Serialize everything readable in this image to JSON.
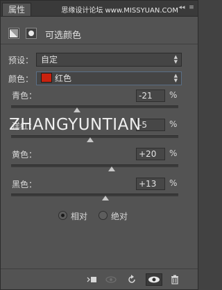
{
  "tabbar": {
    "tab_label": "属性",
    "watermark": "思缘设计论坛 www.MISSYUAN.COM",
    "collapse_glyph": "◂◂",
    "menu_glyph": "≡"
  },
  "header": {
    "title": "可选颜色",
    "icons": [
      "adjustment-layer-icon",
      "layer-mask-icon"
    ]
  },
  "preset": {
    "label": "预设：",
    "value": "自定"
  },
  "colors": {
    "label": "颜色：",
    "value": "红色",
    "swatch_color": "#c8220f"
  },
  "sliders": [
    {
      "label": "青色：",
      "value": "-21",
      "unit": "%",
      "fraction": 0.395
    },
    {
      "label": "洋红：",
      "value": "-5",
      "unit": "%",
      "fraction": 0.475
    },
    {
      "label": "黄色：",
      "value": "+20",
      "unit": "%",
      "fraction": 0.6
    },
    {
      "label": "黑色：",
      "value": "+13",
      "unit": "%",
      "fraction": 0.565
    }
  ],
  "method": {
    "options": [
      {
        "label": "相对",
        "selected": true
      },
      {
        "label": "绝对",
        "selected": false
      }
    ]
  },
  "overlay_text": "ZHANGYUNTIAN",
  "footer": {
    "icons": [
      "clip-to-layer-icon",
      "view-previous-state-icon",
      "reset-icon",
      "visibility-eye-icon",
      "delete-icon"
    ]
  }
}
